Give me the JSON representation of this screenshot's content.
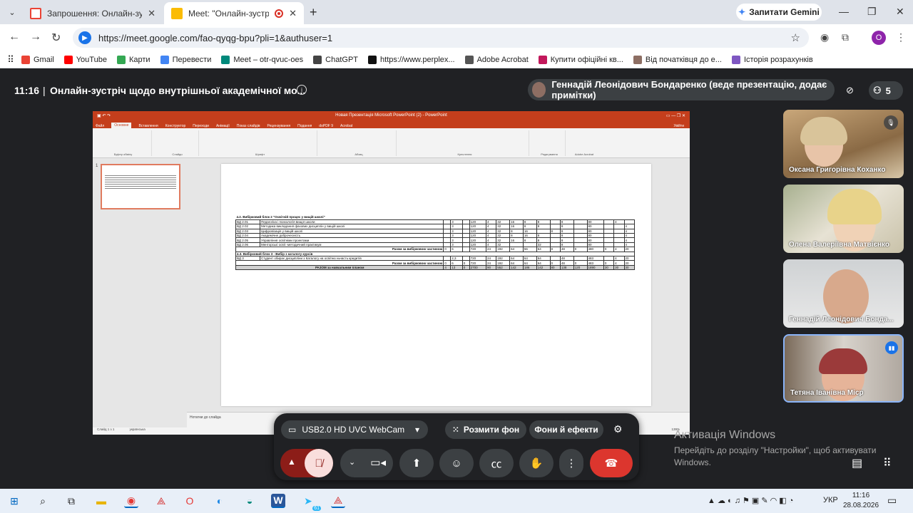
{
  "browser": {
    "tabs": [
      {
        "title": "Запрошення: Онлайн-зустріч з",
        "icon": "gmail-icon",
        "active": false
      },
      {
        "title": "Meet: \"Онлайн-зустріч що",
        "icon": "meet-icon",
        "active": true
      }
    ],
    "gemini_label": "Запитати Gemini",
    "url": "https://meet.google.com/fao-qyqg-bpu?pli=1&authuser=1",
    "profile_initial": "O",
    "bookmarks": [
      {
        "label": "Gmail",
        "color": "#ea4335"
      },
      {
        "label": "YouTube",
        "color": "#ff0000"
      },
      {
        "label": "Карти",
        "color": "#34a853"
      },
      {
        "label": "Перевести",
        "color": "#4285f4"
      },
      {
        "label": "Meet – otr-qvuc-oes",
        "color": "#00897b"
      },
      {
        "label": "ChatGPT",
        "color": "#444444"
      },
      {
        "label": "https://www.perplex...",
        "color": "#111111"
      },
      {
        "label": "Adobe Acrobat",
        "color": "#555555"
      },
      {
        "label": "Купити офіційні кв...",
        "color": "#c2185b"
      },
      {
        "label": "Від початківця до е...",
        "color": "#8d6e63"
      },
      {
        "label": "Історія розрахунків",
        "color": "#7e57c2"
      }
    ]
  },
  "meet": {
    "time": "11:16",
    "separator": "|",
    "title": "Онлайн-зустріч щодо внутрішньої академічної мо...",
    "presenter": "Геннадій Леонідович Бондаренко (веде презентацію, додає примітки)",
    "participant_count": "5",
    "participants": [
      {
        "name": "Оксана Григорівна Коханко",
        "muted": true
      },
      {
        "name": "Олена Валеріївна Матвієнко",
        "muted": false
      },
      {
        "name": "Геннадій Леонідович Бонда...",
        "muted": false
      },
      {
        "name": "Тетяна Іванівна Міср",
        "muted": false
      }
    ],
    "camera": {
      "device": "USB2.0 HD UVC WebCam",
      "blur_label": "Розмити фон",
      "effects_label": "Фони й ефекти"
    }
  },
  "ppt": {
    "window_title": "Новая Презентація Microsoft PowerPoint (2) - PowerPoint",
    "menu": [
      "Файл",
      "Основне",
      "Вставлення",
      "Конструктор",
      "Переходи",
      "Анімації",
      "Показ слайдів",
      "Рецензування",
      "Подання",
      "doPDF 9",
      "Acrobat"
    ],
    "active_menu": "Основне",
    "account": "Увійти",
    "ribbon_groups": [
      "Буфер обміну",
      "Слайди",
      "Шрифт",
      "Абзац",
      "Креслення",
      "Редагування",
      "Adobe Acrobat"
    ],
    "slide_number": "1",
    "table_title": "4.2. Вибірковий блок 2 \"Освітній процес у вищій школі\"",
    "rows": [
      [
        "ВД 2.01",
        "Педагогіка і психологія вищої школи",
        "",
        "3",
        "",
        "120",
        "4",
        "32",
        "16",
        "8",
        "8",
        "",
        "8",
        "",
        "80",
        "",
        "4",
        ""
      ],
      [
        "ВД 2.02",
        "Методика викладання фахових дисциплін у вищій школі",
        "",
        "3",
        "",
        "120",
        "4",
        "32",
        "16",
        "8",
        "8",
        "",
        "8",
        "",
        "80",
        "",
        "",
        "4"
      ],
      [
        "ВД 2.03",
        "Цифровізація у вищій школі",
        "",
        "3",
        "",
        "120",
        "4",
        "32",
        "8",
        "16",
        "",
        "8",
        "8",
        "",
        "80",
        "",
        "",
        "4"
      ],
      [
        "ВД 2.04",
        "Академічне доброчесність",
        "",
        "3",
        "",
        "120",
        "4",
        "32",
        "8",
        "16",
        "8",
        "",
        "8",
        "",
        "80",
        "",
        "",
        "4"
      ],
      [
        "ВД 2.05",
        "Управління освітніми проектами",
        "",
        "3",
        "",
        "120",
        "4",
        "32",
        "16",
        "8",
        "8",
        "",
        "8",
        "",
        "80",
        "",
        "",
        "4"
      ],
      [
        "ВД 2.06",
        "Менторські освіт.-методичний практикум",
        "",
        "3",
        "",
        "120",
        "4",
        "32",
        "",
        "",
        "32",
        "",
        "8",
        "",
        "80",
        "",
        "",
        "4"
      ]
    ],
    "subtotal_label": "Разом за вибірковою частиною",
    "subtotal": [
      "0",
      "6",
      "",
      "720",
      "24",
      "192",
      "64",
      "56",
      "64",
      "8",
      "48",
      "0",
      "480",
      "0",
      "4",
      "20"
    ],
    "block3_title": "4.3. Вибірковий блок 3 - Вибір з каталогу курсів",
    "block3_row": [
      "ВД 3",
      "Студент обирає дисципліни з Каталогу на освітню ньчасть кредитів",
      "",
      "2,3",
      "",
      "720",
      "24",
      "192",
      "64",
      "64",
      "64",
      "",
      "48",
      "",
      "483",
      "",
      "4",
      "20"
    ],
    "block3_subtotal": [
      "0",
      "6",
      "0",
      "720",
      "24",
      "192",
      "64",
      "64",
      "64",
      "0",
      "48",
      "0",
      "483",
      "0",
      "4",
      "20"
    ],
    "total_label": "РАЗОМ за навчальним планом",
    "total": [
      "4",
      "13",
      "0",
      "2700",
      "90",
      "552",
      "142",
      "186",
      "142",
      "80",
      "138",
      "120",
      "1890",
      "30",
      "30",
      "30"
    ],
    "notes_placeholder": "Нотатки до слайда",
    "status": "Слайд 1 з 1",
    "status_lang": "українська",
    "zoom": "139%"
  },
  "windows": {
    "activate_title": "Активація Windows",
    "activate_text": "Перейдіть до розділу \"Настройки\", щоб активувати Windows.",
    "lang": "УКР",
    "time": "11:16",
    "date": "28.08.2026",
    "telegram_badge": "61"
  }
}
